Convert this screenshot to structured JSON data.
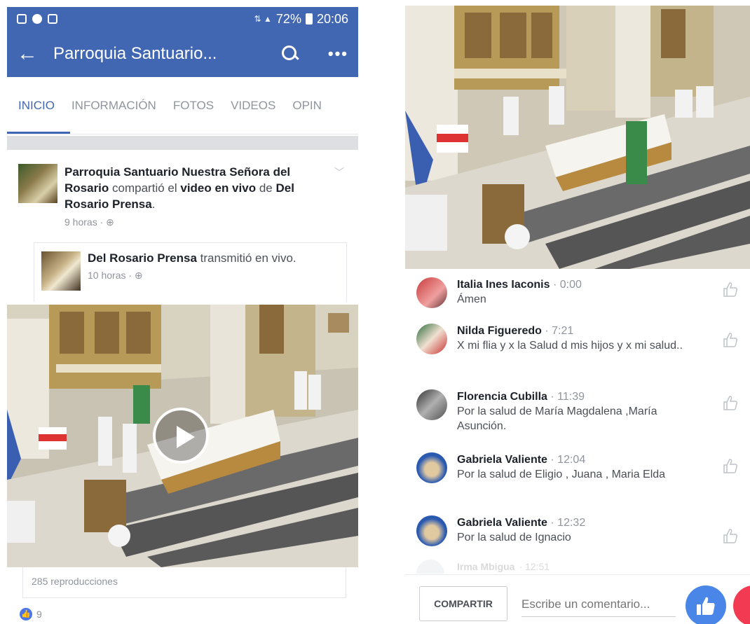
{
  "status_bar": {
    "battery": "72%",
    "time": "20:06"
  },
  "app_bar": {
    "title": "Parroquia Santuario..."
  },
  "tabs": [
    {
      "label": "INICIO",
      "active": true
    },
    {
      "label": "INFORMACIÓN"
    },
    {
      "label": "FOTOS"
    },
    {
      "label": "VIDEOS"
    },
    {
      "label": "OPIN"
    }
  ],
  "post": {
    "page_name": "Parroquia Santuario Nuestra Señora del Rosario",
    "shared_text": "compartió el",
    "video_link": "video en vivo",
    "of_text": "de",
    "source_name": "Del Rosario Prensa",
    "period": ".",
    "time": "9 horas · ⊕",
    "shared": {
      "name": "Del Rosario Prensa",
      "action": "transmitió en vivo.",
      "time": "10 horas · ⊕"
    },
    "views": "285 reproducciones",
    "likes": "9"
  },
  "comments": [
    {
      "name": "Italia Ines Iaconis",
      "time": "· 0:00",
      "text": "Ámen"
    },
    {
      "name": "Nilda Figueredo",
      "time": "· 7:21",
      "text": "X mi flia y x la Salud d mis hijos y x mi salud.."
    },
    {
      "name": "Florencia Cubilla",
      "time": "· 11:39",
      "text": "Por la salud de María Magdalena ,María Asunción."
    },
    {
      "name": "Gabriela Valiente",
      "time": "· 12:04",
      "text": "Por la salud de Eligio , Juana , Maria Elda"
    },
    {
      "name": "Gabriela Valiente",
      "time": "· 12:32",
      "text": "Por la salud de Ignacio"
    }
  ],
  "faded_comment": {
    "name": "Irma Mbigua",
    "time": "· 12:51"
  },
  "bottom_bar": {
    "share_label": "COMPARTIR",
    "comment_placeholder": "Escribe un comentario..."
  },
  "colors": {
    "facebook_blue": "#4267b2",
    "like_blue": "#4a86e8",
    "love_red": "#f23b52"
  }
}
